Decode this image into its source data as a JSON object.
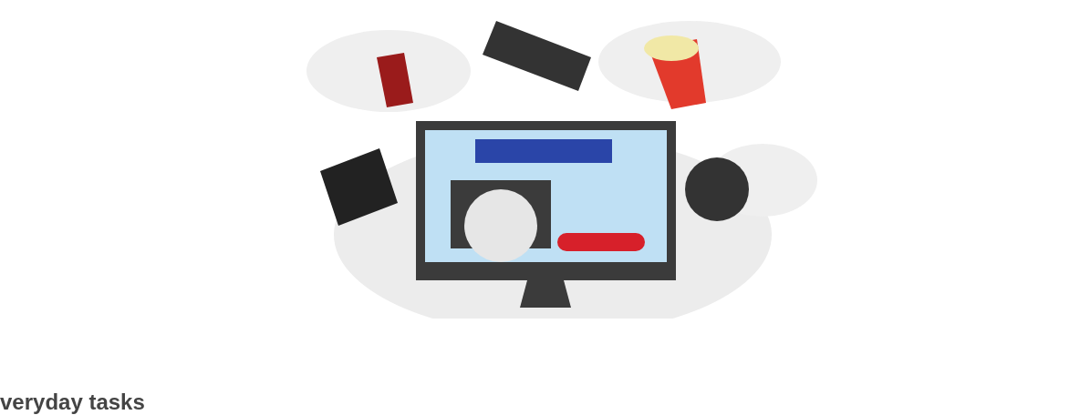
{
  "article": {
    "heading": "veryday tasks"
  }
}
